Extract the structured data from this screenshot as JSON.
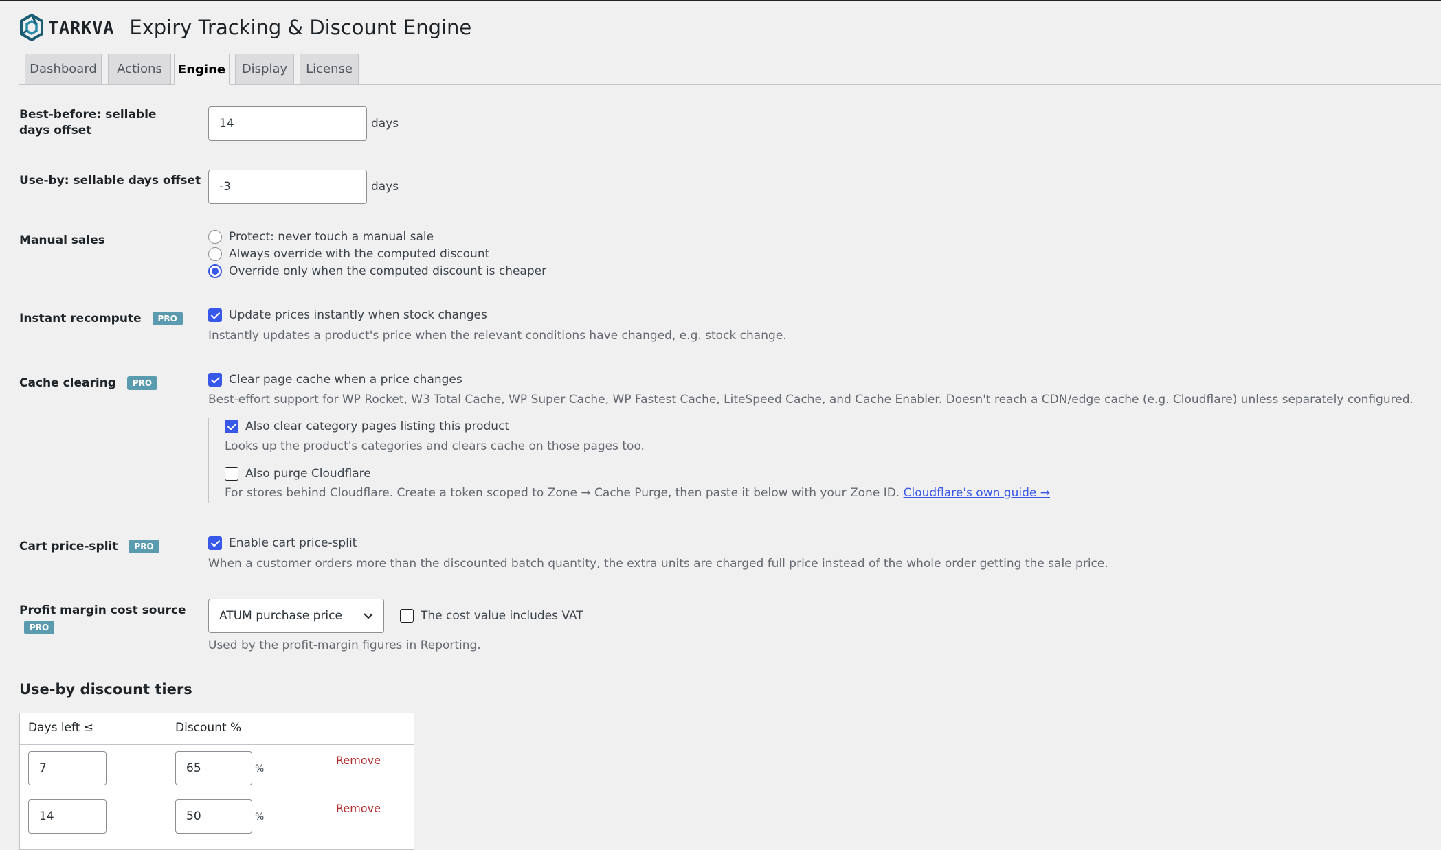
{
  "app": {
    "brand": "TARKVA",
    "title": "Expiry Tracking & Discount Engine"
  },
  "tabs": [
    {
      "label": "Dashboard",
      "active": false
    },
    {
      "label": "Actions",
      "active": false
    },
    {
      "label": "Engine",
      "active": true
    },
    {
      "label": "Display",
      "active": false
    },
    {
      "label": "License",
      "active": false
    }
  ],
  "pro_badge": "PRO",
  "best_before": {
    "label": "Best-before: sellable days offset",
    "value": "14",
    "suffix": "days"
  },
  "use_by": {
    "label": "Use-by: sellable days offset",
    "value": "-3",
    "suffix": "days"
  },
  "manual_sales": {
    "label": "Manual sales",
    "options": [
      {
        "label": "Protect: never touch a manual sale",
        "checked": false
      },
      {
        "label": "Always override with the computed discount",
        "checked": false
      },
      {
        "label": "Override only when the computed discount is cheaper",
        "checked": true
      }
    ]
  },
  "instant_recompute": {
    "label": "Instant recompute",
    "checkbox_label": "Update prices instantly when stock changes",
    "checked": true,
    "description": "Instantly updates a product's price when the relevant conditions have changed, e.g. stock change."
  },
  "cache_clearing": {
    "label": "Cache clearing",
    "checkbox_label": "Clear page cache when a price changes",
    "checked": true,
    "description": "Best-effort support for WP Rocket, W3 Total Cache, WP Super Cache, WP Fastest Cache, LiteSpeed Cache, and Cache Enabler. Doesn't reach a CDN/edge cache (e.g. Cloudflare) unless separately configured.",
    "category": {
      "checkbox_label": "Also clear category pages listing this product",
      "checked": true,
      "description": "Looks up the product's categories and clears cache on those pages too."
    },
    "cloudflare": {
      "checkbox_label": "Also purge Cloudflare",
      "checked": false,
      "description": "For stores behind Cloudflare. Create a token scoped to Zone → Cache Purge, then paste it below with your Zone ID.",
      "link_text": "Cloudflare's own guide →"
    }
  },
  "cart_split": {
    "label": "Cart price-split",
    "checkbox_label": "Enable cart price-split",
    "checked": true,
    "description": "When a customer orders more than the discounted batch quantity, the extra units are charged full price instead of the whole order getting the sale price."
  },
  "profit_margin": {
    "label": "Profit margin cost source",
    "selected": "ATUM purchase price",
    "vat_label": "The cost value includes VAT",
    "vat_checked": false,
    "description": "Used by the profit-margin figures in Reporting."
  },
  "tiers": {
    "heading": "Use-by discount tiers",
    "col_days": "Days left ≤",
    "col_discount": "Discount %",
    "pct_symbol": "%",
    "remove_label": "Remove",
    "rows": [
      {
        "days": "7",
        "discount": "65"
      },
      {
        "days": "14",
        "discount": "50"
      }
    ]
  },
  "colors": {
    "accent": "#3858e9",
    "pro_badge": "#5b9bb0",
    "remove": "#b32d2e",
    "background": "#f0f0f1"
  }
}
